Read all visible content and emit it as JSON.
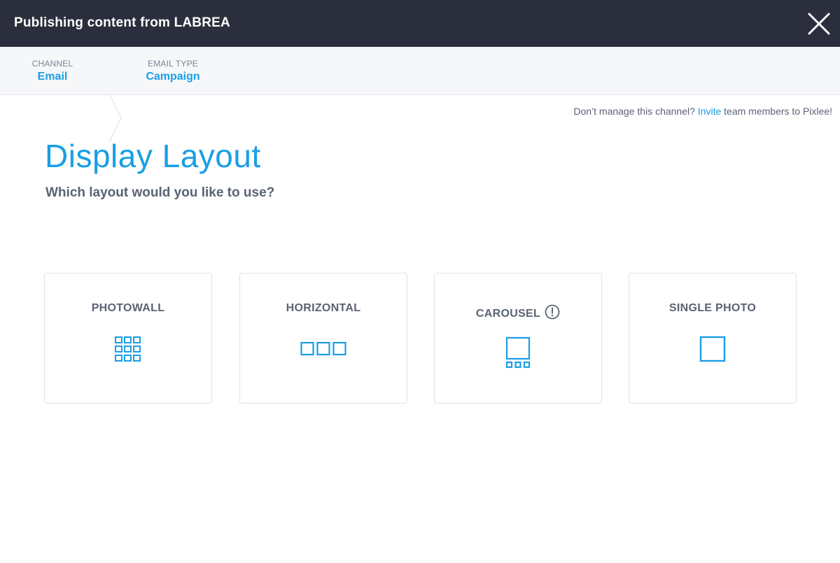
{
  "header": {
    "title": "Publishing content from LABREA"
  },
  "breadcrumbs": [
    {
      "label": "CHANNEL",
      "value": "Email"
    },
    {
      "label": "EMAIL TYPE",
      "value": "Campaign"
    }
  ],
  "invite": {
    "prefix": "Don’t manage this channel?",
    "link": "Invite",
    "suffix": "team members to Pixlee!"
  },
  "main": {
    "title": "Display Layout",
    "subtitle": "Which layout would you like to use?"
  },
  "layouts": [
    {
      "name": "PHOTOWALL",
      "icon": "photowall-grid-icon"
    },
    {
      "name": "HORIZONTAL",
      "icon": "horizontal-row-icon"
    },
    {
      "name": "CAROUSEL",
      "icon": "carousel-icon",
      "info_icon": "info-circle-icon"
    },
    {
      "name": "SINGLE PHOTO",
      "icon": "single-photo-icon"
    }
  ],
  "colors": {
    "header_bg": "#2b2f3d",
    "accent": "#1a9ee5",
    "text": "#5a6373"
  }
}
